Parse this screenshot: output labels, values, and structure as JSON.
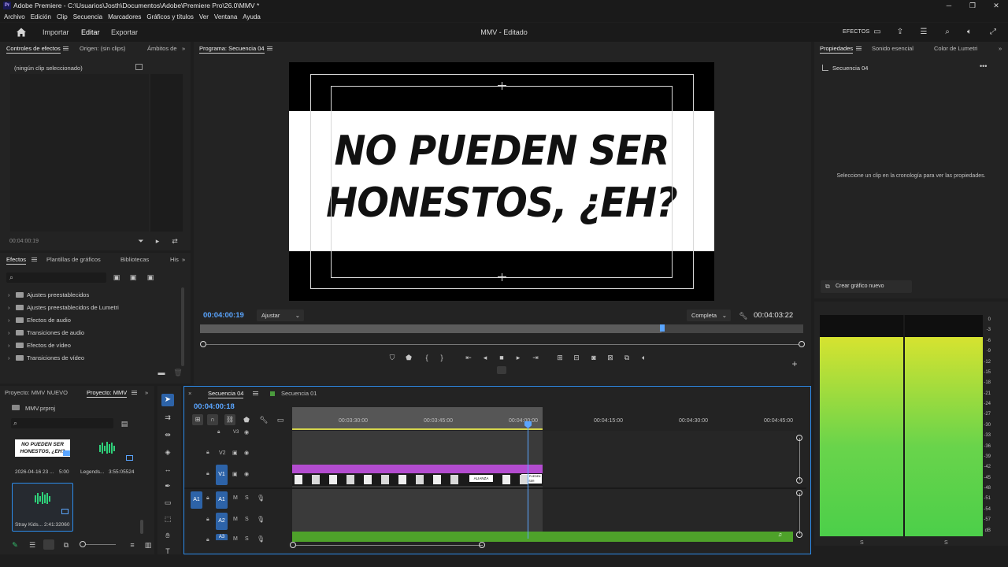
{
  "titlebar": {
    "app_title": "Adobe Premiere - C:\\Usuarios\\Josth\\Documentos\\Adobe\\Premiere Pro\\26.0\\MMV *",
    "logo_text": "Pr"
  },
  "menu": [
    "Archivo",
    "Edición",
    "Clip",
    "Secuencia",
    "Marcadores",
    "Gráficos y títulos",
    "Ver",
    "Ventana",
    "Ayuda"
  ],
  "header": {
    "tabs": [
      "Importar",
      "Editar",
      "Exportar"
    ],
    "active_tab": "Editar",
    "doc_title": "MMV - Editado",
    "efectos_label": "EFECTOS"
  },
  "effect_controls": {
    "tabs": [
      "Controles de efectos",
      "Origen: (sin clips)",
      "Ámbitos de"
    ],
    "no_clip": "(ningún clip seleccionado)",
    "timecode": "00:04:00:19"
  },
  "program_monitor": {
    "tab": "Programa: Secuencia 04",
    "caption_line1": "NO PUEDEN SER",
    "caption_line2": "HONESTOS, ¿EH?",
    "timecode_current": "00:04:00:19",
    "fit_label": "Ajustar",
    "quality_label": "Completa",
    "timecode_duration": "00:04:03:22",
    "playhead_fraction": 0.88
  },
  "properties": {
    "tabs": [
      "Propiedades",
      "Sonido esencial",
      "Color de Lumetri"
    ],
    "sequence_name": "Secuencia 04",
    "hint": "Seleccione un clip en la cronología para ver las propiedades.",
    "new_graphic": "Crear gráfico nuevo"
  },
  "effects": {
    "tabs": [
      "Efectos",
      "Plantillas de gráficos",
      "Bibliotecas",
      "His"
    ],
    "items": [
      "Ajustes preestablecidos",
      "Ajustes preestablecidos de Lumetri",
      "Efectos de audio",
      "Transiciones de audio",
      "Efectos de vídeo",
      "Transiciones de vídeo"
    ]
  },
  "project": {
    "tabs": [
      "Proyecto: MMV NUEVO",
      "Proyecto: MMV"
    ],
    "file": "MMV.prproj",
    "items": [
      {
        "name": "2026-04-16 23 ...",
        "duration": "5:00",
        "thumb_text": "NO PUEDEN SER HONESTOS, ¿EH?"
      },
      {
        "name": "Legends...",
        "duration": "3:55:05524"
      },
      {
        "name": "Stray Kids...",
        "duration": "2:41:32060"
      }
    ]
  },
  "timeline": {
    "tabs": [
      "Secuencia 04",
      "Secuencia 01"
    ],
    "timecode": "00:04:00:18",
    "ruler_labels": [
      "00:03:30:00",
      "00:03:45:00",
      "00:04:00:00",
      "00:04:15:00",
      "00:04:30:00",
      "00:04:45:00"
    ],
    "tracks_video": [
      "V3",
      "V2",
      "V1"
    ],
    "tracks_audio": [
      "A1",
      "A2",
      "A3"
    ],
    "source_patch": "A1",
    "track_buttons": {
      "mute": "M",
      "solo": "S"
    },
    "clip_labels": [
      "ALIANZA",
      "¿NO PUEDEN SER HONESTOS, ¿EH?"
    ]
  },
  "audio_meter": {
    "scale": [
      "0",
      "-3",
      "-6",
      "-9",
      "-12",
      "-15",
      "-18",
      "-21",
      "-24",
      "-27",
      "-30",
      "-33",
      "-36",
      "-39",
      "-42",
      "-45",
      "-48",
      "-51",
      "-54",
      "-57",
      "dB"
    ],
    "channel_labels": [
      "S",
      "S"
    ],
    "left_level_db": -6,
    "right_level_db": -6
  },
  "colors": {
    "accent": "#2d8ceb",
    "timecode_blue": "#5aa5ff",
    "clip_purple": "#b34cd0",
    "audio_green": "#4ea22a"
  }
}
